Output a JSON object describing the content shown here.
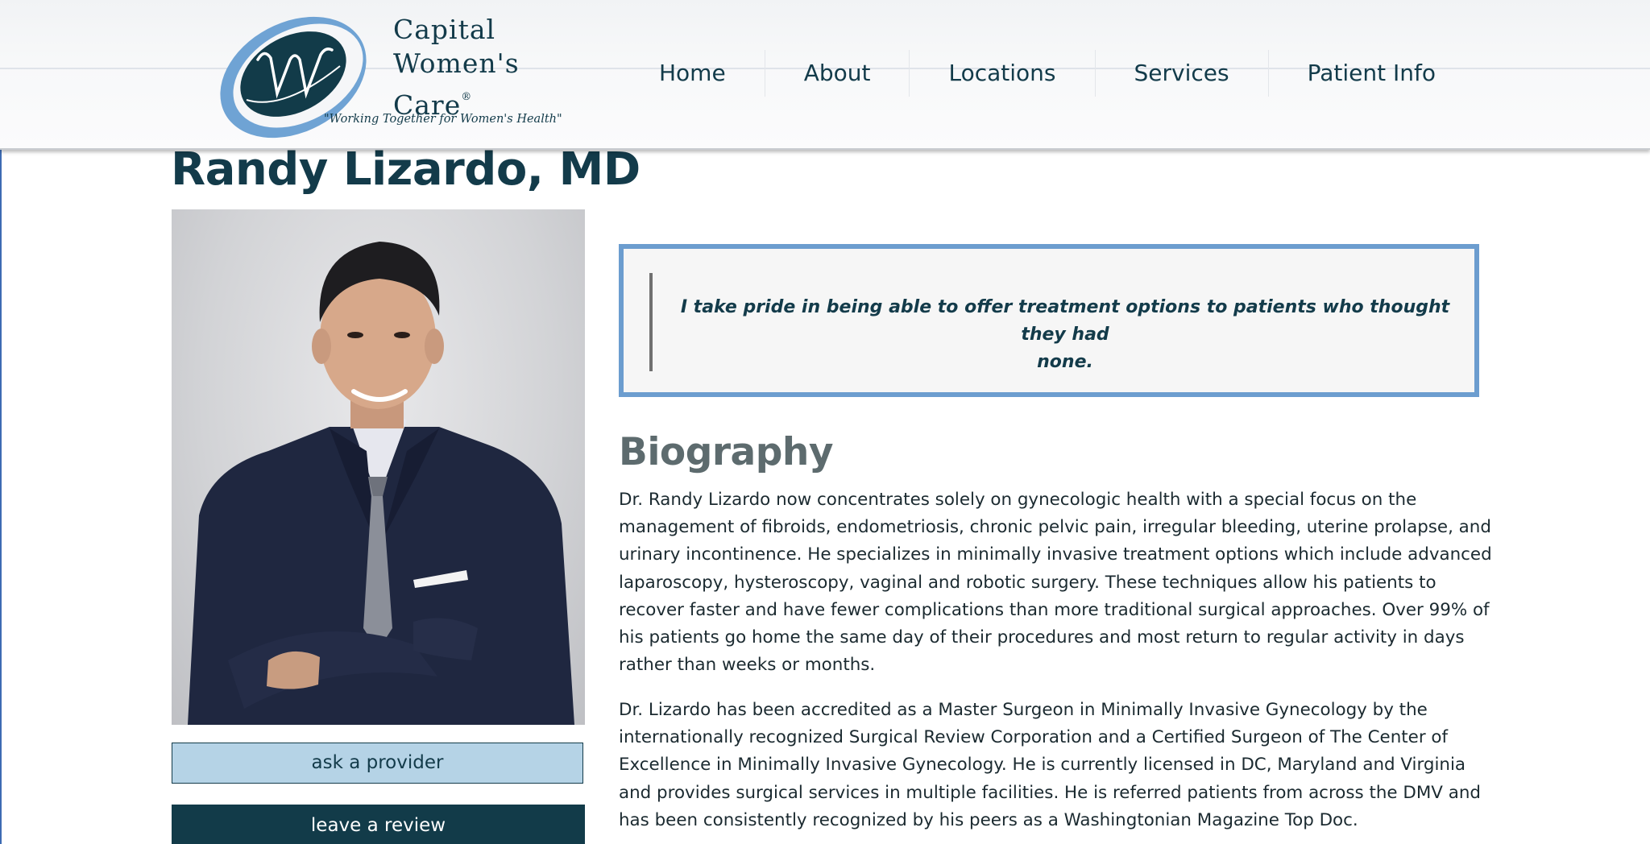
{
  "header": {
    "logo": {
      "line1": "Capital",
      "line2": "Women's",
      "line3": "Care",
      "registered": "®",
      "tagline": "\"Working Together for Women's Health\""
    },
    "nav": [
      "Home",
      "About",
      "Locations",
      "Services",
      "Patient Info"
    ]
  },
  "provider": {
    "name": "Randy Lizardo, MD"
  },
  "buttons": {
    "ask": "ask a provider",
    "review": "leave a review"
  },
  "quote": {
    "line1": "I take pride in being able to offer treatment options to patients who thought they had",
    "line2": "none."
  },
  "biography": {
    "title": "Biography",
    "paragraph1": [
      "Dr. Randy Lizardo now concentrates solely on gynecologic health with a special focus on the",
      "management of fibroids, endometriosis, chronic pelvic pain, irregular bleeding, uterine prolapse, and",
      "urinary incontinence. He specializes in minimally invasive treatment options which include advanced",
      "laparoscopy, hysteroscopy, vaginal and robotic surgery. These techniques allow his patients to",
      "recover faster and have fewer complications than more traditional surgical approaches. Over 99% of",
      "his patients go home the same day of their procedures and most return to regular activity in days",
      "rather than weeks or months."
    ],
    "paragraph2": [
      "Dr. Lizardo has been accredited as a Master Surgeon in Minimally Invasive Gynecology by the",
      "internationally recognized Surgical Review Corporation and a Certified Surgeon of The Center of",
      "Excellence in Minimally Invasive Gynecology. He is currently licensed in DC, Maryland and Virginia",
      "and provides surgical services in multiple facilities. He is referred patients from across the DMV and",
      "has been consistently recognized by his peers as a Washingtonian Magazine Top Doc."
    ]
  },
  "colors": {
    "brand_navy": "#133b4a",
    "accent_blue": "#6c9dcf",
    "ask_button_bg": "#b5d3e6",
    "review_button_bg": "#123b49"
  },
  "icons": {
    "logo_mark": "w-monogram-logo"
  }
}
